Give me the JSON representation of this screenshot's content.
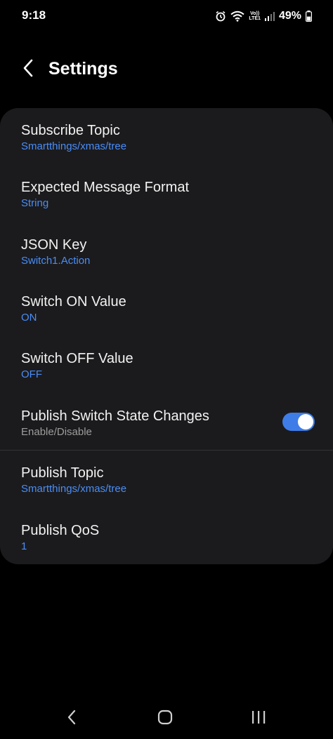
{
  "status_bar": {
    "time": "9:18",
    "volte_top": "Vo))",
    "volte_bottom": "LTE1",
    "battery": "49%",
    "icons": [
      "alarm-icon",
      "wifi-icon",
      "volte-icon",
      "signal-icon",
      "battery-icon"
    ]
  },
  "header": {
    "title": "Settings",
    "back_icon": "chevron-left-icon"
  },
  "settings": {
    "items": [
      {
        "title": "Subscribe Topic",
        "value": "Smartthings/xmas/tree"
      },
      {
        "title": "Expected Message Format",
        "value": "String"
      },
      {
        "title": "JSON Key",
        "value": "Switch1.Action"
      },
      {
        "title": "Switch ON Value",
        "value": "ON"
      },
      {
        "title": "Switch OFF Value",
        "value": "OFF"
      },
      {
        "title": "Publish Switch State Changes",
        "value": "Enable/Disable",
        "toggle_on": true
      },
      {
        "title": "Publish Topic",
        "value": "Smartthings/xmas/tree"
      },
      {
        "title": "Publish QoS",
        "value": "1"
      }
    ]
  },
  "nav_bar": {
    "buttons": [
      "back-nav-icon",
      "home-nav-icon",
      "recents-nav-icon"
    ]
  },
  "colors": {
    "background": "#000000",
    "card": "#1b1b1d",
    "accent_value": "#4a8df7",
    "toggle_on": "#3e7de8",
    "subtext": "#9d9d9d"
  }
}
